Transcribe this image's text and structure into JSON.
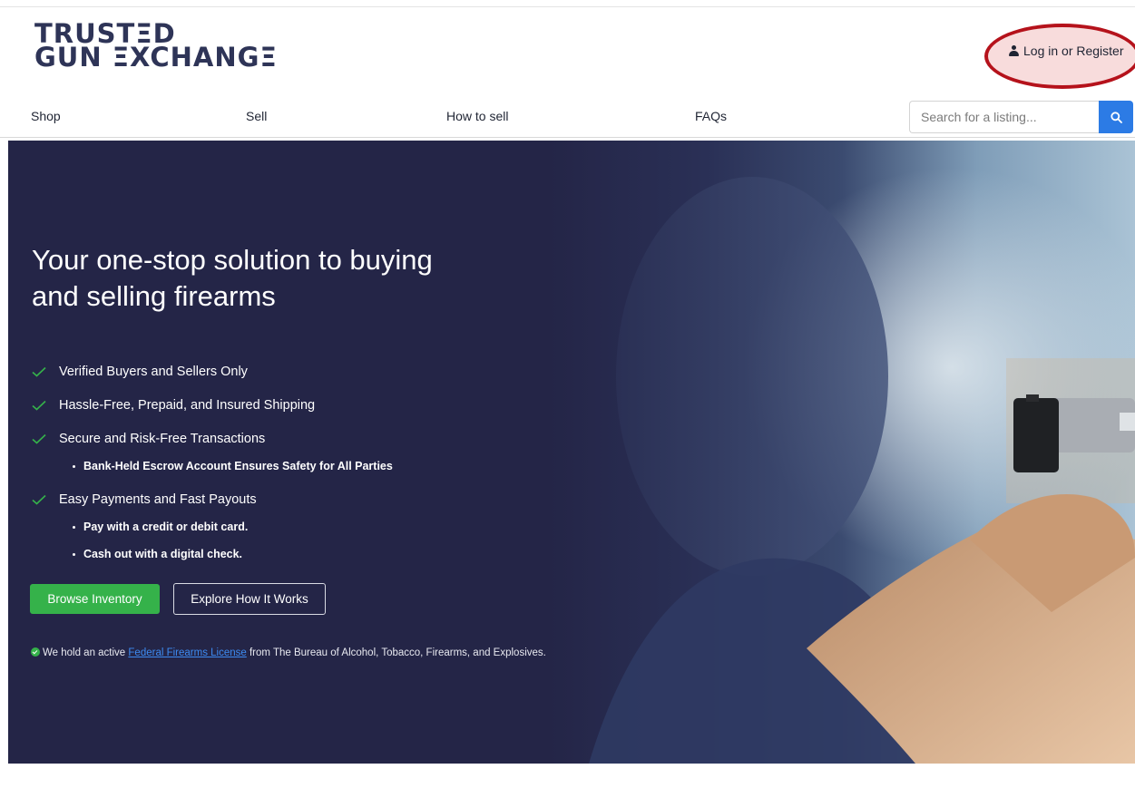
{
  "header": {
    "logo_line1": "TRUSTΞD",
    "logo_line2": "GUN ΞXCHANGΞ",
    "login_label": "Log in or Register"
  },
  "nav": {
    "items": [
      "Shop",
      "Sell",
      "How to sell",
      "FAQs"
    ],
    "search_placeholder": "Search for a listing..."
  },
  "hero": {
    "title_line1": "Your one-stop solution to buying",
    "title_line2": "and selling firearms",
    "features": [
      "Verified Buyers and Sellers Only",
      "Hassle-Free, Prepaid, and Insured Shipping",
      "Secure and Risk-Free Transactions",
      "Bank-Held Escrow Account Ensures Safety for All Parties",
      "Easy Payments and Fast Payouts",
      "Pay with a credit or debit card.",
      "Cash out with a digital check."
    ],
    "browse_label": "Browse Inventory",
    "explore_label": "Explore How It Works",
    "license_prefix": "We hold an active ",
    "license_link": "Federal Firearms License",
    "license_suffix": " from The Bureau of Alcohol, Tobacco, Firearms, and Explosives."
  },
  "colors": {
    "brand_navy": "#242547",
    "logo": "#2e3457",
    "accent_green": "#35b24a",
    "search_blue": "#2c7be5",
    "highlight_red": "#b5121b"
  },
  "icons": [
    "user-icon",
    "search-icon",
    "check-icon",
    "verified-badge-icon"
  ]
}
